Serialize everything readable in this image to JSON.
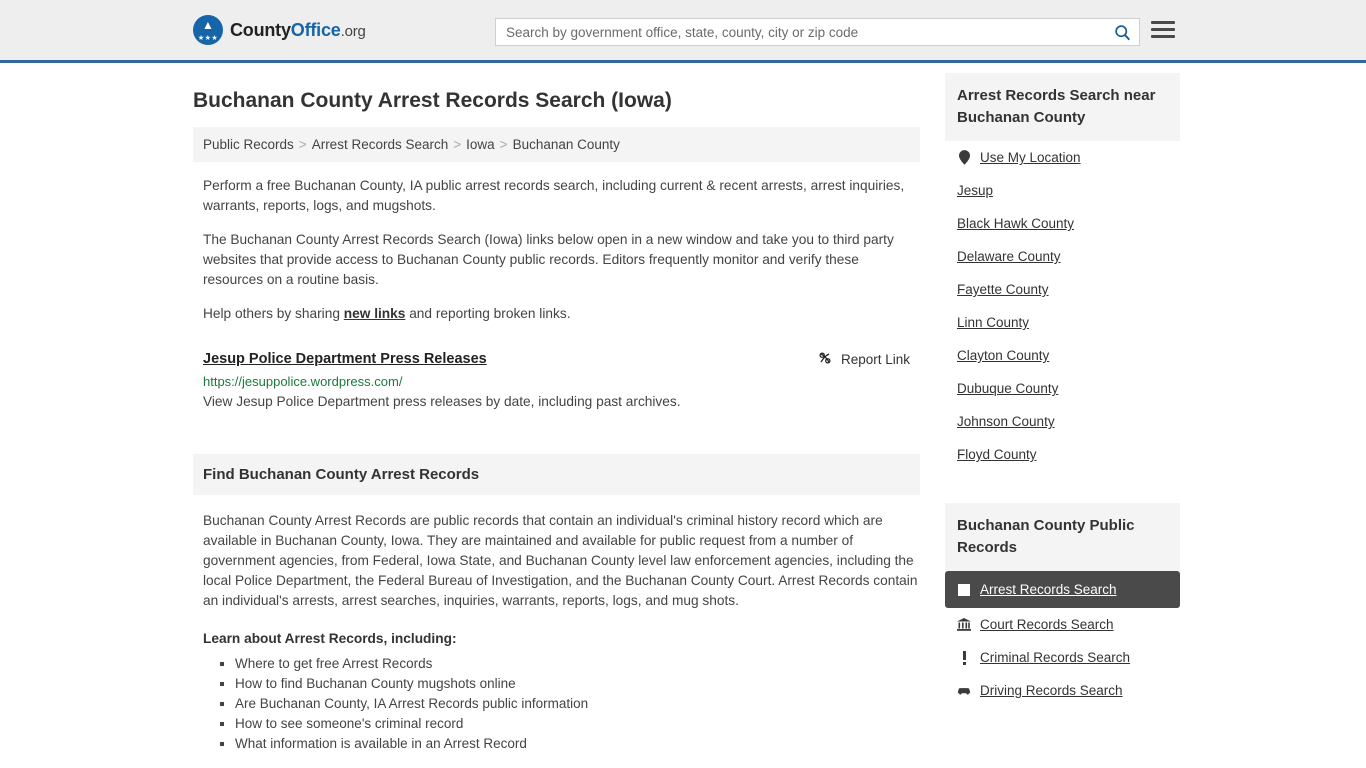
{
  "header": {
    "logo": {
      "part1": "County",
      "part2": "Office",
      "part3": ".org",
      "icon": "eagle-crest-icon"
    },
    "search": {
      "placeholder": "Search by government office, state, county, city or zip code",
      "value": "",
      "button_icon": "search-icon"
    },
    "menu_icon": "hamburger-menu-icon",
    "accent_color": "#31699f"
  },
  "main": {
    "title": "Buchanan County Arrest Records Search (Iowa)",
    "breadcrumb": [
      {
        "label": "Public Records"
      },
      {
        "label": "Arrest Records Search"
      },
      {
        "label": "Iowa"
      },
      {
        "label": "Buchanan County"
      }
    ],
    "breadcrumb_separator": ">",
    "intro": {
      "p1": "Perform a free Buchanan County, IA public arrest records search, including current & recent arrests, arrest inquiries, warrants, reports, logs, and mugshots.",
      "p2": "The Buchanan County Arrest Records Search (Iowa) links below open in a new window and take you to third party websites that provide access to Buchanan County public records. Editors frequently monitor and verify these resources on a routine basis.",
      "p3_before": "Help others by sharing ",
      "p3_link": "new links",
      "p3_after": " and reporting broken links."
    },
    "result": {
      "title": "Jesup Police Department Press Releases",
      "url": "https://jesuppolice.wordpress.com/",
      "description": "View Jesup Police Department press releases by date, including past archives.",
      "report_label": "Report Link",
      "report_icon": "broken-link-icon",
      "url_color": "#1a7a3c"
    },
    "find_section": {
      "heading": "Find Buchanan County Arrest Records",
      "body": "Buchanan County Arrest Records are public records that contain an individual's criminal history record which are available in Buchanan County, Iowa. They are maintained and available for public request from a number of government agencies, from Federal, Iowa State, and Buchanan County level law enforcement agencies, including the local Police Department, the Federal Bureau of Investigation, and the Buchanan County Court. Arrest Records contain an individual's arrests, arrest searches, inquiries, warrants, reports, logs, and mug shots.",
      "learn_heading": "Learn about Arrest Records, including:",
      "learn_items": [
        "Where to get free Arrest Records",
        "How to find Buchanan County mugshots online",
        "Are Buchanan County, IA Arrest Records public information",
        "How to see someone's criminal record",
        "What information is available in an Arrest Record"
      ]
    }
  },
  "sidebar": {
    "near_block": {
      "heading": "Arrest Records Search near Buchanan County",
      "items": [
        {
          "label": "Use My Location",
          "icon": "map-pin-icon"
        },
        {
          "label": "Jesup",
          "icon": ""
        },
        {
          "label": "Black Hawk County",
          "icon": ""
        },
        {
          "label": "Delaware County",
          "icon": ""
        },
        {
          "label": "Fayette County",
          "icon": ""
        },
        {
          "label": "Linn County",
          "icon": ""
        },
        {
          "label": "Clayton County",
          "icon": ""
        },
        {
          "label": "Dubuque County",
          "icon": ""
        },
        {
          "label": "Johnson County",
          "icon": ""
        },
        {
          "label": "Floyd County",
          "icon": ""
        }
      ]
    },
    "public_records_block": {
      "heading": "Buchanan County Public Records",
      "active_color": "#4a4a4a",
      "items": [
        {
          "label": "Arrest Records Search",
          "icon": "square-icon",
          "active": true
        },
        {
          "label": "Court Records Search",
          "icon": "courthouse-icon",
          "active": false
        },
        {
          "label": "Criminal Records Search",
          "icon": "exclamation-icon",
          "active": false
        },
        {
          "label": "Driving Records Search",
          "icon": "car-icon",
          "active": false
        }
      ]
    }
  }
}
